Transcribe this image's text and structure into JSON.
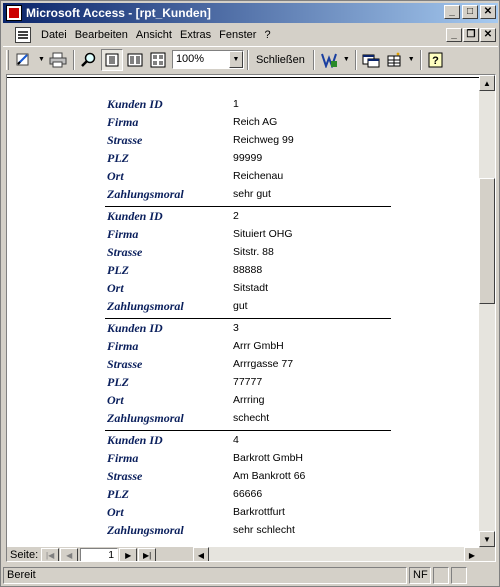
{
  "window": {
    "title": "Microsoft Access - [rpt_Kunden]",
    "title_icon": "access-key-icon"
  },
  "menu": {
    "items": [
      {
        "label": "Datei"
      },
      {
        "label": "Bearbeiten"
      },
      {
        "label": "Ansicht"
      },
      {
        "label": "Extras"
      },
      {
        "label": "Fenster"
      },
      {
        "label": "?"
      }
    ]
  },
  "toolbar": {
    "zoom_value": "100%",
    "close_label": "Schließen",
    "icons": [
      "design-view-icon",
      "print-icon",
      "zoom-icon",
      "one-page-icon",
      "two-pages-icon",
      "multiple-pages-icon",
      "office-links-icon",
      "database-window-icon",
      "new-object-icon",
      "help-icon"
    ]
  },
  "report": {
    "field_labels": {
      "id": "Kunden ID",
      "firma": "Firma",
      "strasse": "Strasse",
      "plz": "PLZ",
      "ort": "Ort",
      "zahlungsmoral": "Zahlungsmoral"
    },
    "records": [
      {
        "id": "1",
        "firma": "Reich AG",
        "strasse": "Reichweg 99",
        "plz": "99999",
        "ort": "Reichenau",
        "zahlungsmoral": "sehr gut"
      },
      {
        "id": "2",
        "firma": "Situiert OHG",
        "strasse": "Sitstr. 88",
        "plz": "88888",
        "ort": "Sitstadt",
        "zahlungsmoral": "gut"
      },
      {
        "id": "3",
        "firma": "Arrr GmbH",
        "strasse": "Arrrgasse 77",
        "plz": "77777",
        "ort": "Arrring",
        "zahlungsmoral": "schecht"
      },
      {
        "id": "4",
        "firma": "Barkrott GmbH",
        "strasse": "Am Bankrott 66",
        "plz": "66666",
        "ort": "Barkrottfurt",
        "zahlungsmoral": "sehr schlecht"
      }
    ]
  },
  "navigation": {
    "page_label": "Seite:",
    "page_number": "1"
  },
  "status": {
    "text": "Bereit",
    "nf": "NF"
  }
}
